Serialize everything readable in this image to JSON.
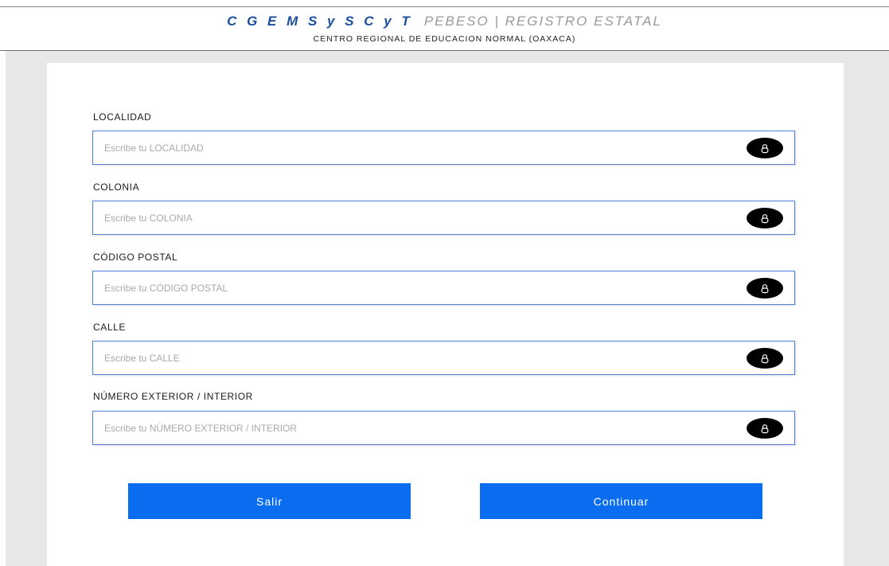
{
  "header": {
    "brand": "C G E M S y S C y T",
    "subtitle": "PEBESO | REGISTRO ESTATAL",
    "institution": "CENTRO REGIONAL DE EDUCACION NORMAL (OAXACA)"
  },
  "form": {
    "fields": [
      {
        "label": "LOCALIDAD",
        "placeholder": "Escribe tu LOCALIDAD",
        "value": "",
        "icon": "lock-icon"
      },
      {
        "label": "COLONIA",
        "placeholder": "Escribe tu COLONIA",
        "value": "",
        "icon": "lock-icon"
      },
      {
        "label": "CÓDIGO POSTAL",
        "placeholder": "Escribe tu CÓDIGO POSTAL",
        "value": "",
        "icon": "lock-icon"
      },
      {
        "label": "CALLE",
        "placeholder": "Escribe tu CALLE",
        "value": "",
        "icon": "lock-icon"
      },
      {
        "label": "NÚMERO EXTERIOR / INTERIOR",
        "placeholder": "Escribe tu NÚMERO EXTERIOR / INTERIOR",
        "value": "",
        "icon": "lock-icon"
      }
    ]
  },
  "actions": {
    "exit_label": "Salir",
    "continue_label": "Continuar"
  },
  "colors": {
    "brand": "#1b4f9c",
    "button": "#0a6df0",
    "field_border": "#4f7fd9",
    "background": "#e7e7e7"
  }
}
